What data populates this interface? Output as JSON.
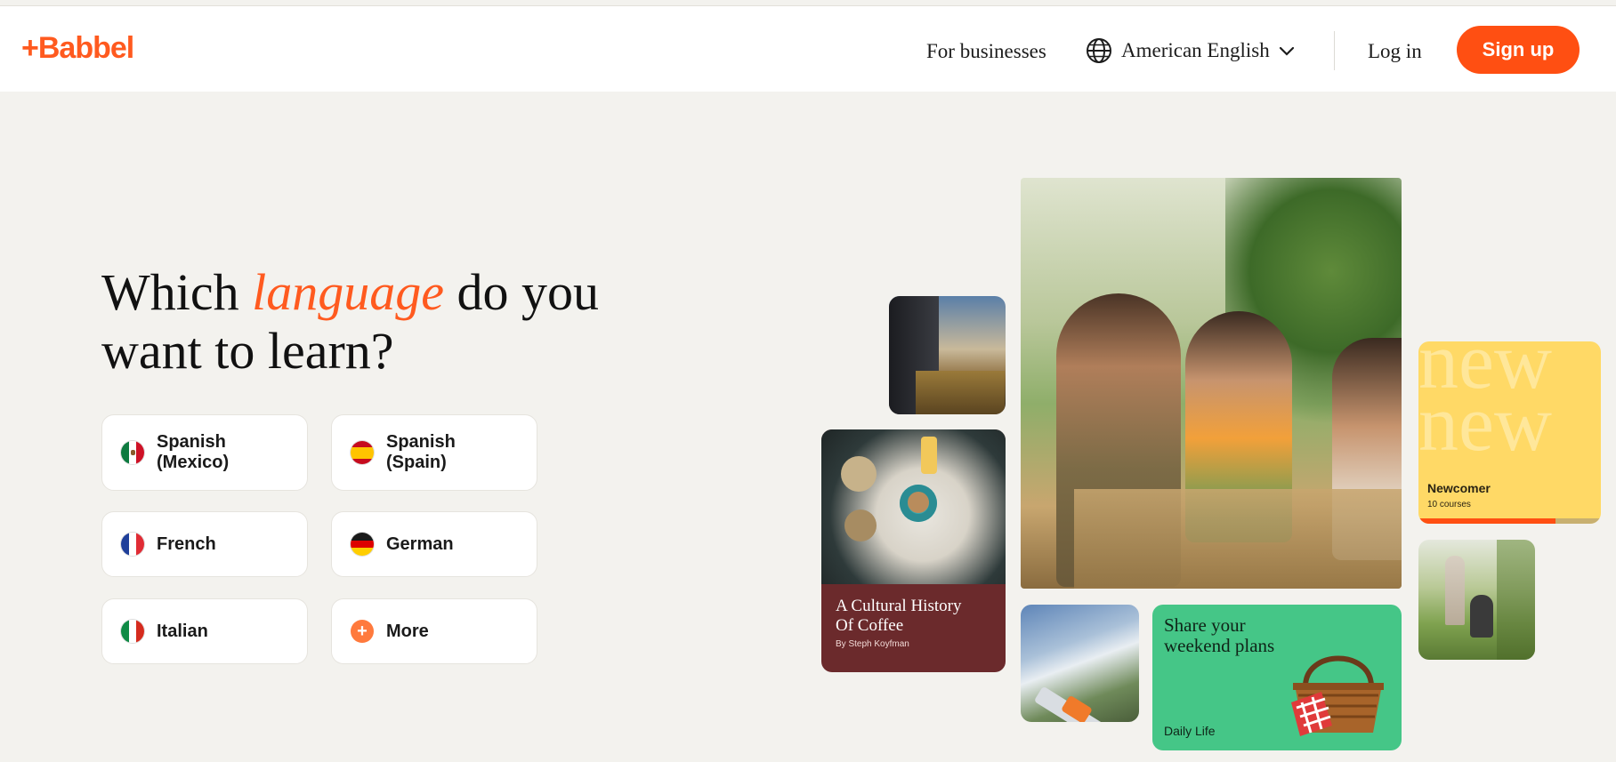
{
  "header": {
    "logo": "+Babbel",
    "for_businesses": "For businesses",
    "language_selector": "American English",
    "login": "Log in",
    "signup": "Sign up"
  },
  "hero": {
    "title_pre": "Which ",
    "title_em": "language",
    "title_post": " do you want to learn?",
    "languages": [
      {
        "label_line1": "Spanish",
        "label_line2": "(Mexico)",
        "flag": "mexico-flag-icon"
      },
      {
        "label_line1": "Spanish",
        "label_line2": "(Spain)",
        "flag": "spain-flag-icon"
      },
      {
        "label": "French",
        "flag": "france-flag-icon"
      },
      {
        "label": "German",
        "flag": "germany-flag-icon"
      },
      {
        "label": "Italian",
        "flag": "italy-flag-icon"
      },
      {
        "label": "More",
        "flag": "plus-icon"
      }
    ]
  },
  "gallery": {
    "coffee_card": {
      "title_line1": "A Cultural History",
      "title_line2": "Of Coffee",
      "author": "By Steph Koyfman"
    },
    "newcomer_card": {
      "watermark": "new",
      "title": "Newcomer",
      "subtitle": "10 courses",
      "progress": 0.75
    },
    "weekend_card": {
      "title_line1": "Share your",
      "title_line2": "weekend plans",
      "category": "Daily Life"
    }
  },
  "colors": {
    "brand": "#ff5a1f",
    "signup_bg": "#ff4f12",
    "page_bg": "#f3f2ee",
    "coffee_card_bg": "#6b2a2c",
    "newcomer_bg": "#ffd966",
    "weekend_bg": "#45c687"
  }
}
